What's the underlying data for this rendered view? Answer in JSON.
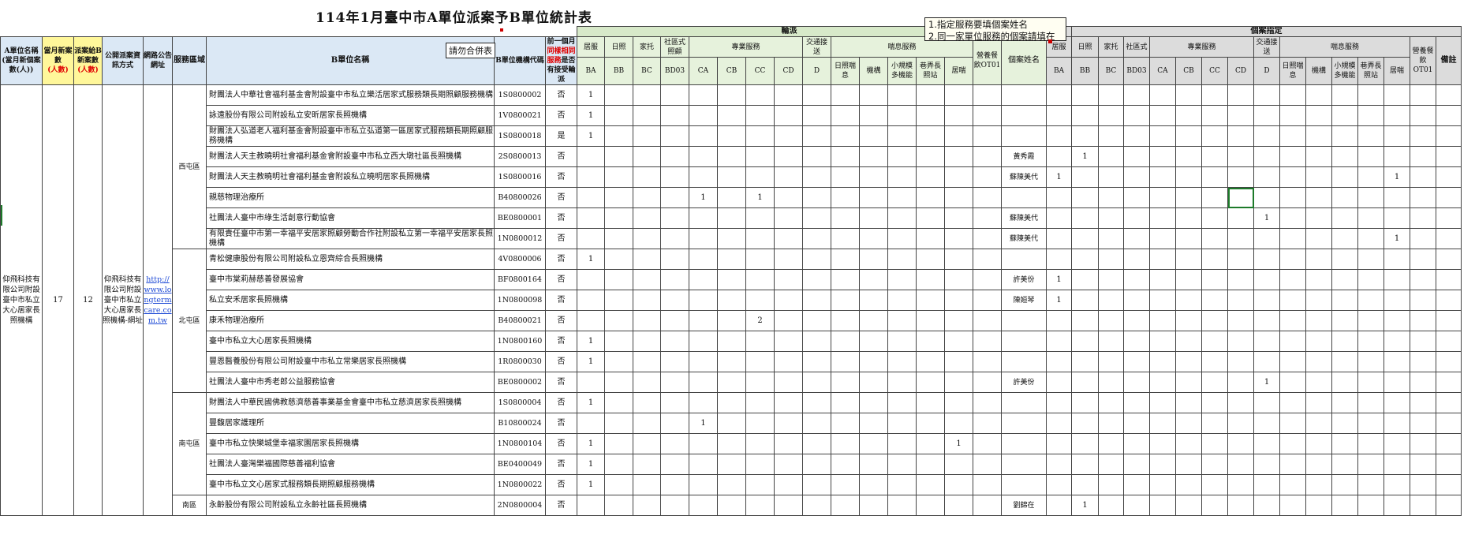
{
  "title": "114年1月臺中市A單位派案予B單位統計表",
  "note": {
    "line1": "1.指定服務要填個案姓名",
    "line2": "2.同一家單位服務的個案請填在"
  },
  "merge_tag": "請勿合併表",
  "headers": {
    "a_unit": "A單位名稱(當月新個案數(人))",
    "month_new": "當月新案數",
    "month_new_unit": "(人數)",
    "dispatch_b": "派案給B新案數",
    "dispatch_b_unit": "(人數)",
    "publish": "公開派案資訊方式",
    "url": "網路公告網址",
    "area": "服務區域",
    "b_name": "B單位名稱",
    "b_code": "B單位機構代碼",
    "prev_pre": "前一個月",
    "prev_red": "同樣相同服務",
    "prev_post": "是否有接受輪派",
    "dispatch_group": "輪派",
    "case_group": "個案指定",
    "pro_service": "專業服務",
    "transport": "交通接送",
    "respite": "喘息服務",
    "nursing": "營養餐飲OT01",
    "case_name": "個案姓名",
    "remark": "備註",
    "subs1": [
      "居服",
      "日照",
      "家托",
      "社區式照顧"
    ],
    "subs2": [
      "日照喘息",
      "機構",
      "小規模多機能",
      "巷弄長照站",
      "居喘"
    ],
    "codes": [
      "BA",
      "BB",
      "BC",
      "BD03",
      "CA",
      "CB",
      "CC",
      "CD",
      "D"
    ],
    "subs1b": [
      "居服",
      "日照",
      "家托",
      "社區式"
    ],
    "subs2b": [
      "日照喘息",
      "機構",
      "小規模多機能",
      "巷弄長照站",
      "居喘"
    ]
  },
  "left": {
    "a_unit_name": "仰飛科技有限公司附設臺中市私立大心居家長照機構",
    "month_new": "17",
    "dispatch_b": "12",
    "publish": "仰飛科技有限公司附設臺中市私立大心居家長照機構-網址",
    "url": "http://www.longtermcare.com.tw"
  },
  "areas": [
    "西屯區",
    "北屯區",
    "南屯區",
    "南區"
  ],
  "rows": [
    {
      "name": "財團法人中華社會福利基金會附設臺中市私立樂活居家式服務類長期照顧服務機構",
      "code": "1S0800002",
      "prev": "否",
      "BA": "1"
    },
    {
      "name": "詠遠股份有限公司附設私立安昕居家長照機構",
      "code": "1V0800021",
      "prev": "否",
      "BA": "1"
    },
    {
      "name": "財團法人弘道老人福利基金會附設臺中市私立弘道第一區居家式服務類長期照顧服務機構",
      "code": "1S0800018",
      "prev": "是",
      "BA": "1"
    },
    {
      "name": "財團法人天主教曉明社會福利基金會附設臺中市私立西大墩社區長照機構",
      "code": "2S0800013",
      "prev": "否",
      "case": "黃秀霞",
      "cBB": "1"
    },
    {
      "name": "財團法人天主教曉明社會福利基金會附設私立曉明居家長照機構",
      "code": "1S0800016",
      "prev": "否",
      "case": "蘇陳美代",
      "cBA": "1",
      "cRes": "1"
    },
    {
      "name": "親慈物理治療所",
      "code": "B40800026",
      "prev": "否",
      "CA": "1",
      "CC": "1"
    },
    {
      "name": "社團法人臺中市綠生活創意行動協會",
      "code": "BE0800001",
      "prev": "否",
      "case": "蘇陳美代",
      "cD": "1"
    },
    {
      "name": "有限責任臺中市第一幸福平安居家照顧勞動合作社附設私立第一幸福平安居家長照機構",
      "code": "1N0800012",
      "prev": "否",
      "case": "蘇陳美代",
      "cRes": "1"
    },
    {
      "name": "青松健康股份有限公司附設私立恩齊綜合長照機構",
      "code": "4V0800006",
      "prev": "否",
      "BA": "1"
    },
    {
      "name": "臺中市棠莉赫慈善發展協會",
      "code": "BF0800164",
      "prev": "否",
      "case": "許美份",
      "cBA": "1"
    },
    {
      "name": "私立安禾居家長照機構",
      "code": "1N0800098",
      "prev": "否",
      "case": "陳姮琴",
      "cBA": "1"
    },
    {
      "name": "康禾物理治療所",
      "code": "B40800021",
      "prev": "否",
      "CC": "2"
    },
    {
      "name": "臺中市私立大心居家長照機構",
      "code": "1N0800160",
      "prev": "否",
      "BA": "1"
    },
    {
      "name": "豐恩醫養股份有限公司附設臺中市私立常樂居家長照機構",
      "code": "1R0800030",
      "prev": "否",
      "BA": "1"
    },
    {
      "name": "社團法人臺中市秀老郎公益服務協會",
      "code": "BE0800002",
      "prev": "否",
      "case": "許美份",
      "cD": "1"
    },
    {
      "name": "財團法人中華民國佛教慈濟慈善事業基金會臺中市私立慈濟居家長照機構",
      "code": "1S0800004",
      "prev": "否",
      "BA": "1"
    },
    {
      "name": "豐馥居家護理所",
      "code": "B10800024",
      "prev": "否",
      "CA": "1"
    },
    {
      "name": "臺中市私立快樂城堡幸福家園居家長照機構",
      "code": "1N0800104",
      "prev": "否",
      "BA": "1",
      "Res": "1"
    },
    {
      "name": "社團法人臺灣樂福國際慈善福利協會",
      "code": "BE0400049",
      "prev": "否",
      "BA": "1"
    },
    {
      "name": "臺中市私立文心居家式服務類長期照顧服務機構",
      "code": "1N0800022",
      "prev": "否",
      "BA": "1"
    },
    {
      "name": "永齡股份有限公司附設私立永齡社區長照機構",
      "code": "2N0800004",
      "prev": "否",
      "case": "劉錦在",
      "cBB": "1"
    }
  ]
}
